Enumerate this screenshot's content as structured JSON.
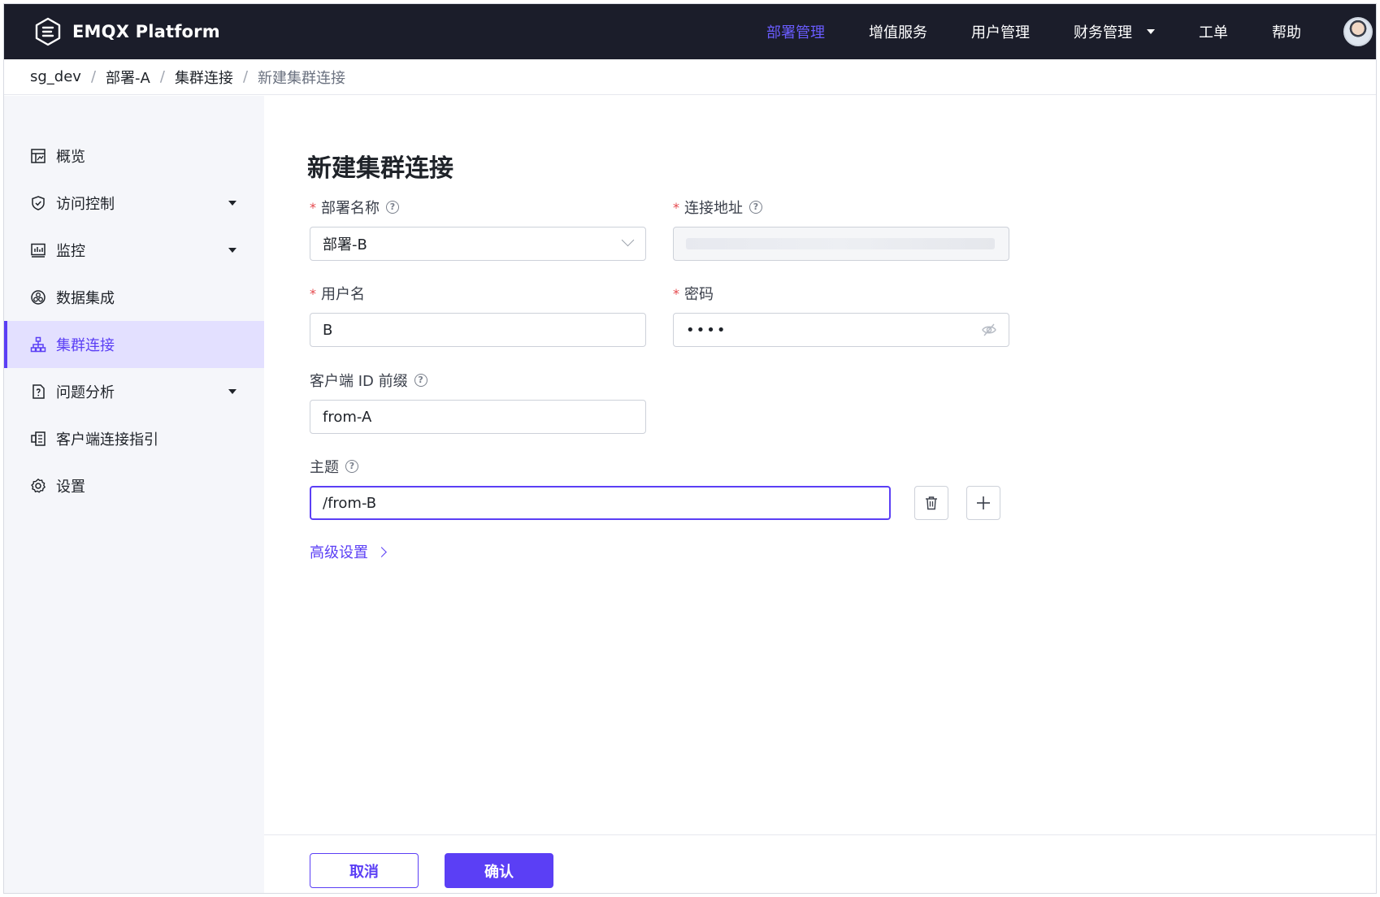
{
  "app": {
    "name": "EMQX Platform"
  },
  "nav": {
    "items": [
      {
        "label": "部署管理",
        "active": true
      },
      {
        "label": "增值服务"
      },
      {
        "label": "用户管理"
      },
      {
        "label": "财务管理",
        "dropdown": true
      },
      {
        "label": "工单"
      },
      {
        "label": "帮助"
      }
    ]
  },
  "breadcrumb": [
    "sg_dev",
    "部署-A",
    "集群连接",
    "新建集群连接"
  ],
  "sidebar": {
    "items": [
      {
        "label": "概览",
        "icon": "overview-icon"
      },
      {
        "label": "访问控制",
        "icon": "shield-icon",
        "dropdown": true
      },
      {
        "label": "监控",
        "icon": "monitor-chart-icon",
        "dropdown": true
      },
      {
        "label": "数据集成",
        "icon": "data-integration-icon"
      },
      {
        "label": "集群连接",
        "icon": "cluster-link-icon",
        "active": true
      },
      {
        "label": "问题分析",
        "icon": "issue-analysis-icon",
        "dropdown": true
      },
      {
        "label": "客户端连接指引",
        "icon": "client-guide-icon"
      },
      {
        "label": "设置",
        "icon": "gear-icon"
      }
    ]
  },
  "form": {
    "title": "新建集群连接",
    "deployment": {
      "label": "部署名称",
      "value": "部署-B"
    },
    "address": {
      "label": "连接地址",
      "value": ""
    },
    "username": {
      "label": "用户名",
      "value": "B"
    },
    "password": {
      "label": "密码",
      "value": "••••"
    },
    "client_prefix": {
      "label": "客户端 ID 前缀",
      "value": "from-A"
    },
    "topic": {
      "label": "主题",
      "value": "/from-B"
    },
    "advanced": "高级设置",
    "required_mark": "*"
  },
  "actions": {
    "cancel": "取消",
    "confirm": "确认"
  },
  "colors": {
    "accent": "#5b3ff5",
    "topbar": "#1b1d2a",
    "nav_active": "#6a5cff"
  }
}
